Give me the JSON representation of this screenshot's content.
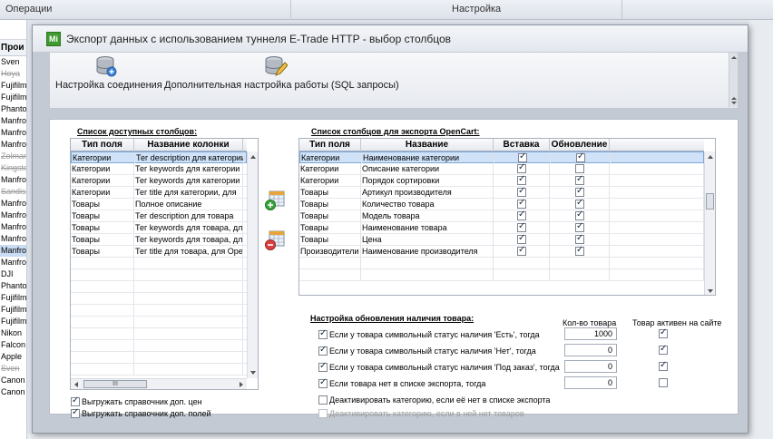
{
  "background": {
    "tabs": [
      "Операции",
      "Настройка"
    ],
    "list_header": "Прои",
    "list_items": [
      {
        "text": "Sven",
        "strike": false,
        "sel": false
      },
      {
        "text": "Hoya",
        "strike": true,
        "sel": false
      },
      {
        "text": "Fujifilm",
        "strike": false,
        "sel": false
      },
      {
        "text": "Fujifilm",
        "strike": false,
        "sel": false
      },
      {
        "text": "Phantom",
        "strike": false,
        "sel": false
      },
      {
        "text": "Manfrotto",
        "strike": false,
        "sel": false
      },
      {
        "text": "Manfrotto",
        "strike": false,
        "sel": false
      },
      {
        "text": "Manfrotto",
        "strike": false,
        "sel": false
      },
      {
        "text": "Zolmann",
        "strike": true,
        "sel": false
      },
      {
        "text": "Kingston",
        "strike": true,
        "sel": false
      },
      {
        "text": "Manfrotto",
        "strike": false,
        "sel": false
      },
      {
        "text": "Sandisk",
        "strike": true,
        "sel": false
      },
      {
        "text": "Manfrotto",
        "strike": false,
        "sel": false
      },
      {
        "text": "Manfrotto",
        "strike": false,
        "sel": false
      },
      {
        "text": "Manfrotto",
        "strike": false,
        "sel": false
      },
      {
        "text": "Manfrotto",
        "strike": false,
        "sel": false
      },
      {
        "text": "Manfrotto",
        "strike": false,
        "sel": true
      },
      {
        "text": "Manfrotto",
        "strike": false,
        "sel": false
      },
      {
        "text": "DJI",
        "strike": false,
        "sel": false
      },
      {
        "text": "Phantom",
        "strike": false,
        "sel": false
      },
      {
        "text": "Fujifilm",
        "strike": false,
        "sel": false
      },
      {
        "text": "Fujifilm",
        "strike": false,
        "sel": false
      },
      {
        "text": "Fujifilm",
        "strike": false,
        "sel": false
      },
      {
        "text": "Nikon",
        "strike": false,
        "sel": false
      },
      {
        "text": "Falcon",
        "strike": false,
        "sel": false
      },
      {
        "text": "Apple",
        "strike": false,
        "sel": false
      },
      {
        "text": "Sven",
        "strike": true,
        "sel": false
      },
      {
        "text": "Canon",
        "strike": false,
        "sel": false
      },
      {
        "text": "Canon",
        "strike": false,
        "sel": false
      }
    ]
  },
  "dialog": {
    "title": "Экспорт данных с использованием туннеля E-Trade HTTP - выбор столбцов",
    "app_icon": "Мi",
    "ribbon": [
      {
        "label": "Настройка соединения",
        "icon": "database-connection-icon"
      },
      {
        "label": "Дополнительная настройка работы (SQL запросы)",
        "icon": "database-edit-icon"
      }
    ],
    "available": {
      "label": "Список доступных столбцов:",
      "headers": [
        "Тип поля",
        "Название колонки"
      ],
      "rows": [
        [
          "Категории",
          "Тег description для категории"
        ],
        [
          "Категории",
          "Тег keywords для категории"
        ],
        [
          "Категории",
          "Тег keywords для категории"
        ],
        [
          "Категории",
          "Тег title для категории, для"
        ],
        [
          "Товары",
          "Полное описание"
        ],
        [
          "Товары",
          "Тег description для товара"
        ],
        [
          "Товары",
          "Тег keywords для товара, для"
        ],
        [
          "Товары",
          "Тег keywords для товара, для"
        ],
        [
          "Товары",
          "Тег title для товара, для Ope"
        ]
      ],
      "hscroll_grip": "III"
    },
    "export": {
      "label": "Список столбцов для экспорта OpenCart:",
      "headers": [
        "Тип поля",
        "Название",
        "Вставка",
        "Обновление"
      ],
      "rows": [
        {
          "type": "Категории",
          "name": "Наименование категории",
          "insert": true,
          "update": true
        },
        {
          "type": "Категории",
          "name": "Описание категории",
          "insert": true,
          "update": false
        },
        {
          "type": "Категории",
          "name": "Порядок сортировки",
          "insert": true,
          "update": true
        },
        {
          "type": "Товары",
          "name": "Артикул производителя",
          "insert": true,
          "update": true
        },
        {
          "type": "Товары",
          "name": "Количество товара",
          "insert": true,
          "update": true
        },
        {
          "type": "Товары",
          "name": "Модель товара",
          "insert": true,
          "update": true
        },
        {
          "type": "Товары",
          "name": "Наименование товара",
          "insert": true,
          "update": true
        },
        {
          "type": "Товары",
          "name": "Цена",
          "insert": true,
          "update": true
        },
        {
          "type": "Производители",
          "name": "Наименование производителя",
          "insert": true,
          "update": true
        }
      ]
    },
    "left_options": [
      {
        "label": "Выгружать справочник доп. цен",
        "checked": true
      },
      {
        "label": "Выгружать справочник доп. полей",
        "checked": true
      }
    ],
    "availability": {
      "label": "Настройка обновления наличия товара:",
      "col_qty": "Кол-во товара",
      "col_active": "Товар активен на сайте",
      "rows": [
        {
          "label": "Если у товара символьный статус наличия 'Есть', тогда",
          "checked": true,
          "qty": "1000",
          "active": true
        },
        {
          "label": "Если у товара символьный статус наличия 'Нет', тогда",
          "checked": true,
          "qty": "0",
          "active": true
        },
        {
          "label": "Если у товара символьный статус наличия 'Под заказ', тогда",
          "checked": true,
          "qty": "0",
          "active": true
        },
        {
          "label": "Если товара нет в списке экспорта, тогда",
          "checked": true,
          "qty": "0",
          "active": false
        }
      ],
      "extra": [
        {
          "label": "Деактивировать категорию, если её нет в списке экспорта",
          "checked": false,
          "disabled": false
        },
        {
          "label": "Деактивировать категорию, если в ней нет товаров",
          "checked": false,
          "disabled": true
        }
      ]
    }
  }
}
